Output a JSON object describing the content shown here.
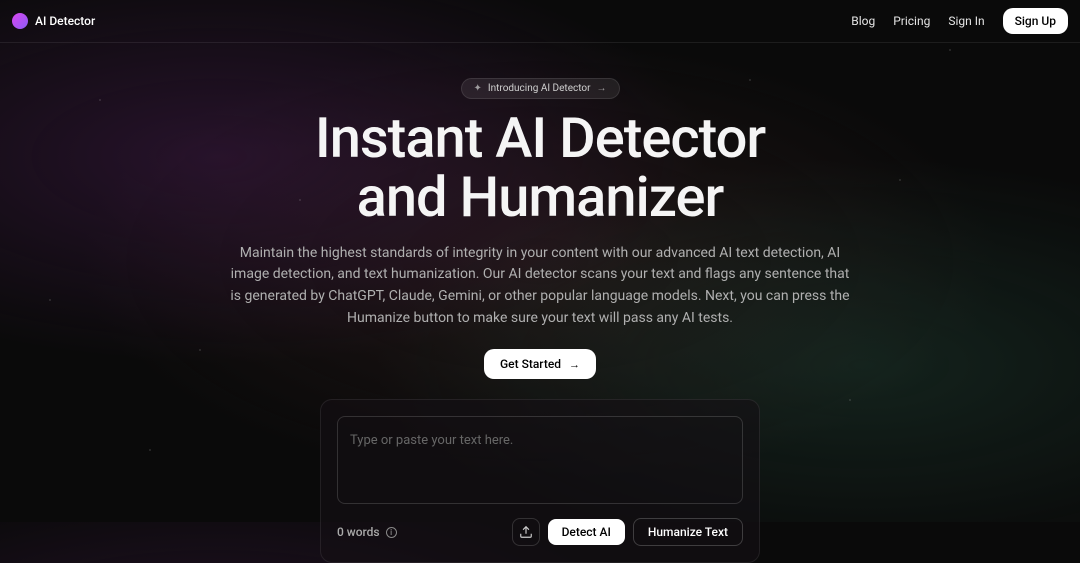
{
  "brand": {
    "name": "AI Detector"
  },
  "nav": {
    "blog": "Blog",
    "pricing": "Pricing",
    "signin": "Sign In",
    "signup": "Sign Up"
  },
  "pill": {
    "text": "Introducing AI Detector"
  },
  "hero": {
    "heading_line1": "Instant AI Detector",
    "heading_line2": "and Humanizer",
    "subheading": "Maintain the highest standards of integrity in your content with our advanced AI text detection, AI image detection, and text humanization. Our AI detector scans your text and flags any sentence that is generated by ChatGPT, Claude, Gemini, or other popular language models. Next, you can press the Humanize button to make sure your text will pass any AI tests.",
    "get_started": "Get Started"
  },
  "input": {
    "placeholder": "Type or paste your text here.",
    "word_count": "0 words"
  },
  "actions": {
    "detect": "Detect AI",
    "humanize": "Humanize Text"
  }
}
